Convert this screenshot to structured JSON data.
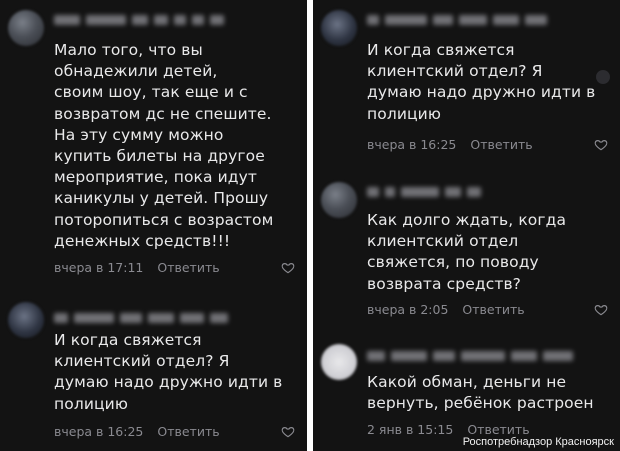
{
  "left": {
    "comments": [
      {
        "text": "Мало того, что вы\nобнадежили детей,\nсвоим шоу, так еще и с\nвозвратом дс не спешите.\nНа эту сумму можно\nкупить билеты на другое\nмероприятие, пока идут\nканикулы у детей. Прошу\nпоторопиться с возрастом\nденежных средств!!!",
        "time": "вчера в 17:11",
        "reply": "Ответить",
        "icon": "heart-icon"
      },
      {
        "text": "И когда свяжется\nклиентский отдел? Я\nдумаю надо дружно идти в\nполицию",
        "time": "вчера в 16:25",
        "reply": "Ответить",
        "icon": "heart-icon"
      }
    ]
  },
  "right": {
    "comments": [
      {
        "text": "И когда свяжется\nклиентский отдел? Я\nдумаю надо дружно идти в\nполицию",
        "time": "вчера в 16:25",
        "reply": "Ответить",
        "icon": "heart-icon"
      },
      {
        "text": "Как долго ждать, когда\nклиентский отдел\nсвяжется, по поводу\nвозврата средств?",
        "time": "вчера в 2:05",
        "reply": "Ответить",
        "icon": "heart-icon"
      },
      {
        "text": "Какой обман, деньги не\nвернуть, ребёнок растроен",
        "time": "2 янв в 15:15",
        "reply": "Ответить",
        "icon": "heart-icon"
      }
    ]
  },
  "watermark": "Роспотребнадзор Красноярск",
  "colors": {
    "background": "#131313",
    "text": "#e9e9ea",
    "meta": "#8a8a90"
  }
}
